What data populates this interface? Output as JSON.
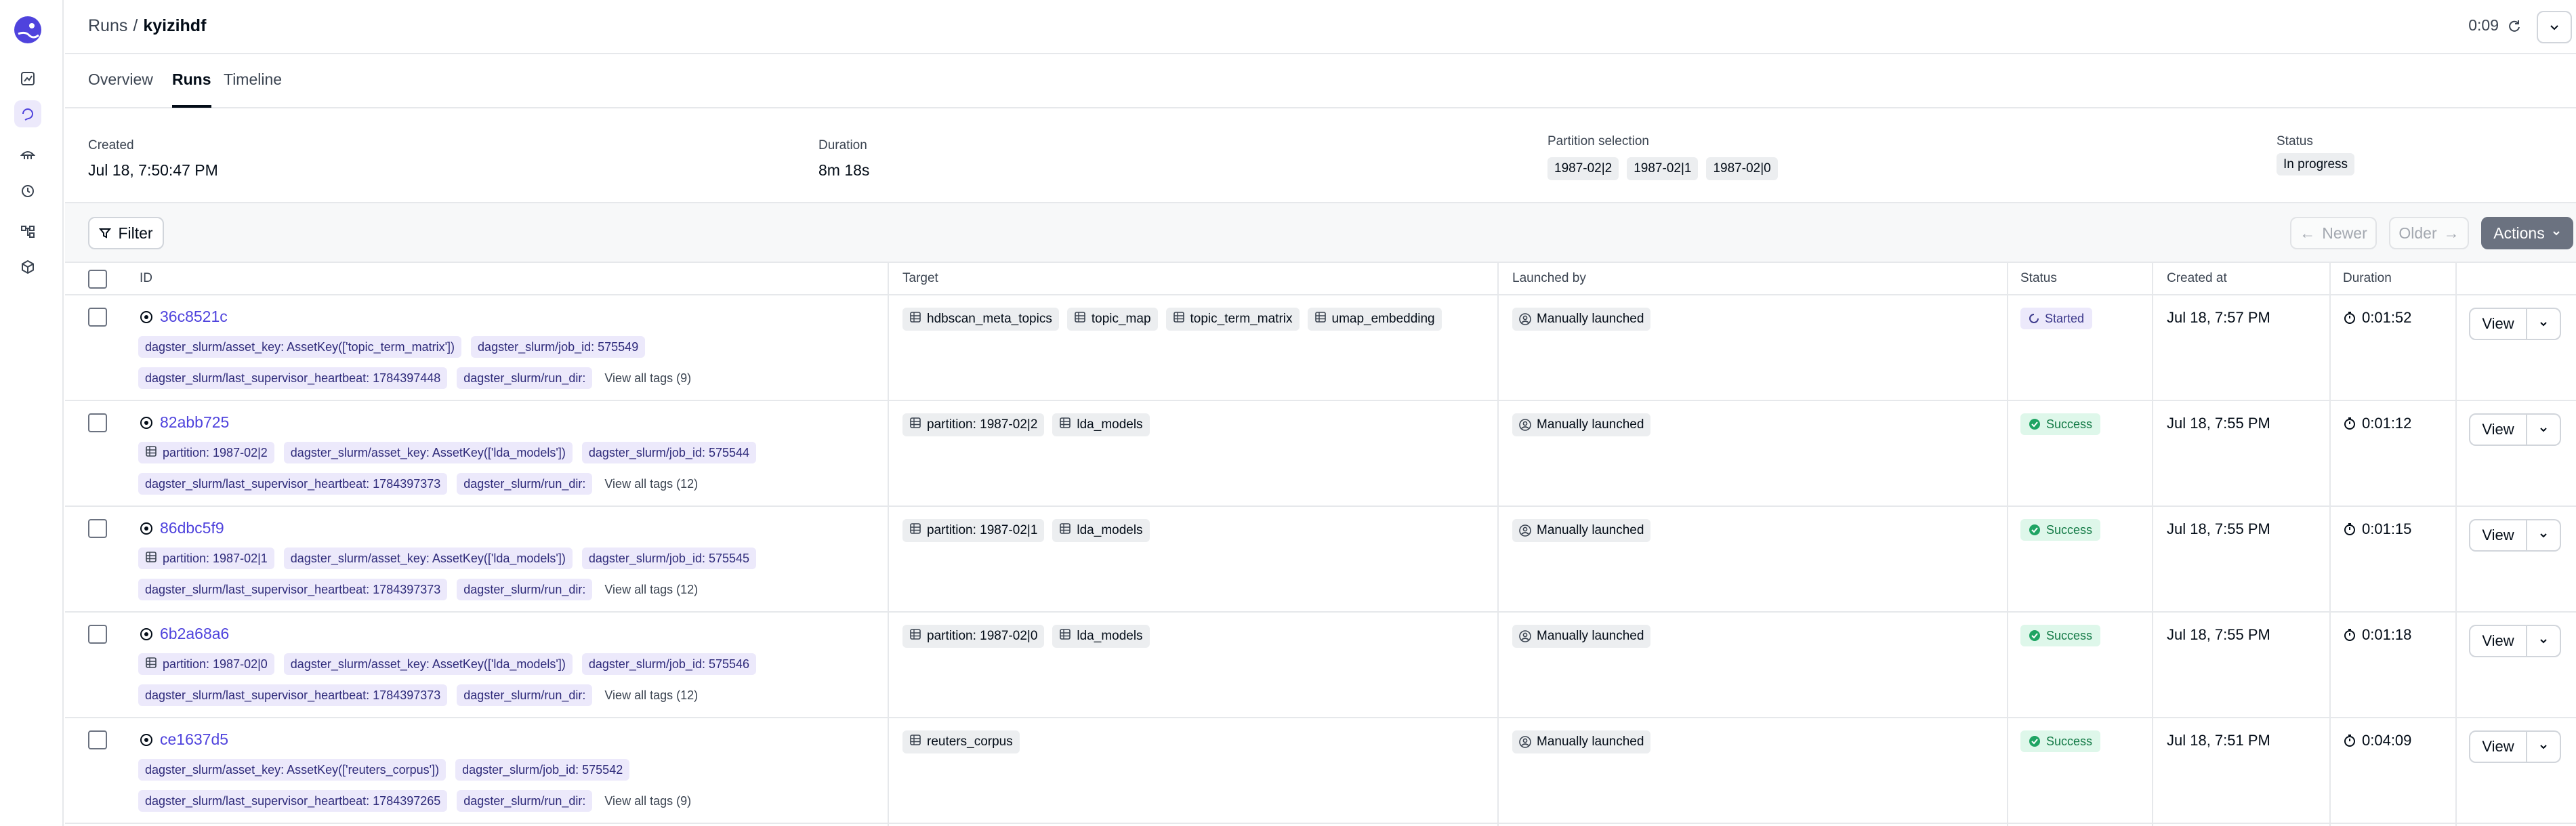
{
  "header": {
    "breadcrumb_root": "Runs",
    "breadcrumb_sep": "/",
    "breadcrumb_current": "kyizihdf",
    "timer": "0:09"
  },
  "tabs": [
    {
      "label": "Overview",
      "active": false
    },
    {
      "label": "Runs",
      "active": true
    },
    {
      "label": "Timeline",
      "active": false
    }
  ],
  "summary": {
    "created_label": "Created",
    "created_value": "Jul 18, 7:50:47 PM",
    "duration_label": "Duration",
    "duration_value": "8m 18s",
    "partition_label": "Partition selection",
    "partitions": [
      "1987-02|2",
      "1987-02|1",
      "1987-02|0"
    ],
    "status_label": "Status",
    "status_value": "In progress"
  },
  "toolbar": {
    "filter_label": "Filter",
    "newer_label": "Newer",
    "older_label": "Older",
    "actions_label": "Actions"
  },
  "table": {
    "columns": [
      "ID",
      "Target",
      "Launched by",
      "Status",
      "Created at",
      "Duration"
    ],
    "view_label": "View",
    "rows": [
      {
        "id": "36c8521c",
        "tags": [
          "dagster_slurm/asset_key: AssetKey(['topic_term_matrix'])",
          "dagster_slurm/job_id: 575549",
          "dagster_slurm/last_supervisor_heartbeat: 1784397448",
          "dagster_slurm/run_dir:"
        ],
        "view_all": "View all tags (9)",
        "targets": [
          "hdbscan_meta_topics",
          "topic_map",
          "topic_term_matrix",
          "umap_embedding"
        ],
        "launched_by": "Manually launched",
        "status": "Started",
        "created": "Jul 18, 7:57 PM",
        "duration": "0:01:52"
      },
      {
        "id": "82abb725",
        "partition_tag": "partition: 1987-02|2",
        "tags": [
          "dagster_slurm/asset_key: AssetKey(['lda_models'])",
          "dagster_slurm/job_id: 575544",
          "dagster_slurm/last_supervisor_heartbeat: 1784397373",
          "dagster_slurm/run_dir:"
        ],
        "view_all": "View all tags (12)",
        "targets": [
          "partition: 1987-02|2",
          "lda_models"
        ],
        "launched_by": "Manually launched",
        "status": "Success",
        "created": "Jul 18, 7:55 PM",
        "duration": "0:01:12"
      },
      {
        "id": "86dbc5f9",
        "partition_tag": "partition: 1987-02|1",
        "tags": [
          "dagster_slurm/asset_key: AssetKey(['lda_models'])",
          "dagster_slurm/job_id: 575545",
          "dagster_slurm/last_supervisor_heartbeat: 1784397373",
          "dagster_slurm/run_dir:"
        ],
        "view_all": "View all tags (12)",
        "targets": [
          "partition: 1987-02|1",
          "lda_models"
        ],
        "launched_by": "Manually launched",
        "status": "Success",
        "created": "Jul 18, 7:55 PM",
        "duration": "0:01:15"
      },
      {
        "id": "6b2a68a6",
        "partition_tag": "partition: 1987-02|0",
        "tags": [
          "dagster_slurm/asset_key: AssetKey(['lda_models'])",
          "dagster_slurm/job_id: 575546",
          "dagster_slurm/last_supervisor_heartbeat: 1784397373",
          "dagster_slurm/run_dir:"
        ],
        "view_all": "View all tags (12)",
        "targets": [
          "partition: 1987-02|0",
          "lda_models"
        ],
        "launched_by": "Manually launched",
        "status": "Success",
        "created": "Jul 18, 7:55 PM",
        "duration": "0:01:18"
      },
      {
        "id": "ce1637d5",
        "tags": [
          "dagster_slurm/asset_key: AssetKey(['reuters_corpus'])",
          "dagster_slurm/job_id: 575542",
          "dagster_slurm/last_supervisor_heartbeat: 1784397265",
          "dagster_slurm/run_dir:"
        ],
        "view_all": "View all tags (9)",
        "targets": [
          "reuters_corpus"
        ],
        "launched_by": "Manually launched",
        "status": "Success",
        "created": "Jul 18, 7:51 PM",
        "duration": "0:04:09"
      }
    ]
  },
  "icons": {
    "logo": "dagster-logo-icon",
    "nav": [
      "overview-icon",
      "runs-icon",
      "assets-icon",
      "schedules-icon",
      "lineage-icon",
      "deployment-icon"
    ]
  },
  "colors": {
    "accent": "#4f43dd",
    "tag_bg": "#ece9fb",
    "success_bg": "#def7ea",
    "success_fg": "#137a46"
  }
}
